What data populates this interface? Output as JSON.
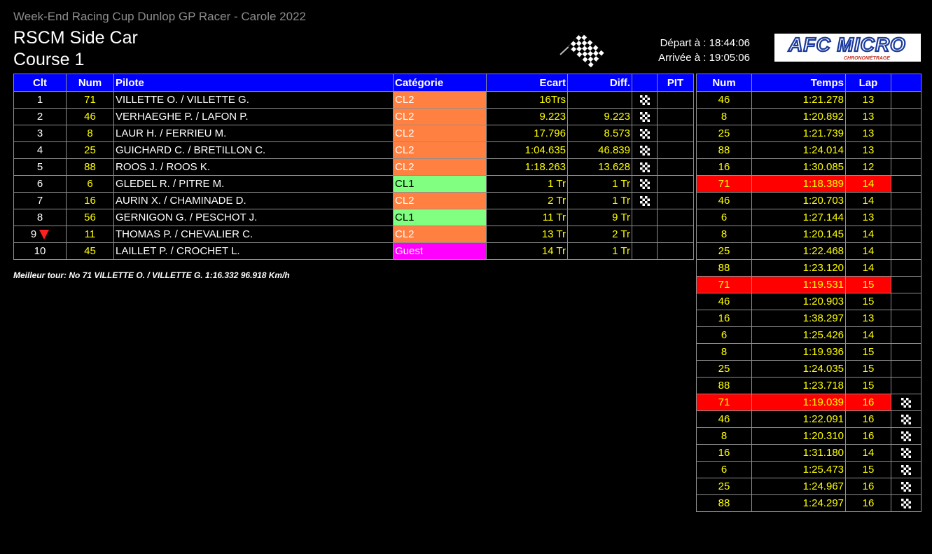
{
  "header": {
    "event": "Week-End Racing Cup Dunlop GP Racer - Carole 2022",
    "series": "RSCM Side Car",
    "race": "Course 1",
    "start": "Départ à : 18:44:06",
    "finish": "Arrivée à : 19:05:06",
    "logo_text": "AFC MICRO",
    "logo_sub": "CHRONOMÉTRAGE"
  },
  "standings": {
    "headers": [
      "Clt",
      "Num",
      "Pilote",
      "Catégorie",
      "Ecart",
      "Diff.",
      "",
      "PIT"
    ],
    "rows": [
      {
        "pos": "1",
        "num": "71",
        "pilot": "VILLETTE O. / VILLETTE G.",
        "cat": "CL2",
        "gap": "16Trs",
        "diff": "",
        "flag": true,
        "pit": "",
        "down": false
      },
      {
        "pos": "2",
        "num": "46",
        "pilot": "VERHAEGHE P. / LAFON P.",
        "cat": "CL2",
        "gap": "9.223",
        "diff": "9.223",
        "flag": true,
        "pit": "",
        "down": false
      },
      {
        "pos": "3",
        "num": "8",
        "pilot": "LAUR H. / FERRIEU M.",
        "cat": "CL2",
        "gap": "17.796",
        "diff": "8.573",
        "flag": true,
        "pit": "",
        "down": false
      },
      {
        "pos": "4",
        "num": "25",
        "pilot": "GUICHARD C. / BRETILLON C.",
        "cat": "CL2",
        "gap": "1:04.635",
        "diff": "46.839",
        "flag": true,
        "pit": "",
        "down": false
      },
      {
        "pos": "5",
        "num": "88",
        "pilot": "ROOS J. / ROOS K.",
        "cat": "CL2",
        "gap": "1:18.263",
        "diff": "13.628",
        "flag": true,
        "pit": "",
        "down": false
      },
      {
        "pos": "6",
        "num": "6",
        "pilot": "GLEDEL R. / PITRE M.",
        "cat": "CL1",
        "gap": "1 Tr",
        "diff": "1 Tr",
        "flag": true,
        "pit": "",
        "down": false
      },
      {
        "pos": "7",
        "num": "16",
        "pilot": "AURIN X. / CHAMINADE D.",
        "cat": "CL2",
        "gap": "2 Tr",
        "diff": "1 Tr",
        "flag": true,
        "pit": "",
        "down": false
      },
      {
        "pos": "8",
        "num": "56",
        "pilot": "GERNIGON G. / PESCHOT J.",
        "cat": "CL1",
        "gap": "11 Tr",
        "diff": "9 Tr",
        "flag": false,
        "pit": "",
        "down": false
      },
      {
        "pos": "9",
        "num": "11",
        "pilot": "THOMAS P. / CHEVALIER C.",
        "cat": "CL2",
        "gap": "13 Tr",
        "diff": "2 Tr",
        "flag": false,
        "pit": "",
        "down": true
      },
      {
        "pos": "10",
        "num": "45",
        "pilot": "LAILLET P. / CROCHET L.",
        "cat": "Guest",
        "gap": "14 Tr",
        "diff": "1 Tr",
        "flag": false,
        "pit": "",
        "down": false
      }
    ]
  },
  "best_lap": "Meilleur tour: No 71 VILLETTE O. / VILLETTE G. 1:16.332 96.918 Km/h",
  "laps": {
    "headers": [
      "Num",
      "Temps",
      "Lap",
      ""
    ],
    "rows": [
      {
        "num": "46",
        "time": "1:21.278",
        "lap": "13",
        "best": false,
        "flag": false
      },
      {
        "num": "8",
        "time": "1:20.892",
        "lap": "13",
        "best": false,
        "flag": false
      },
      {
        "num": "25",
        "time": "1:21.739",
        "lap": "13",
        "best": false,
        "flag": false
      },
      {
        "num": "88",
        "time": "1:24.014",
        "lap": "13",
        "best": false,
        "flag": false
      },
      {
        "num": "16",
        "time": "1:30.085",
        "lap": "12",
        "best": false,
        "flag": false
      },
      {
        "num": "71",
        "time": "1:18.389",
        "lap": "14",
        "best": true,
        "flag": false
      },
      {
        "num": "46",
        "time": "1:20.703",
        "lap": "14",
        "best": false,
        "flag": false
      },
      {
        "num": "6",
        "time": "1:27.144",
        "lap": "13",
        "best": false,
        "flag": false
      },
      {
        "num": "8",
        "time": "1:20.145",
        "lap": "14",
        "best": false,
        "flag": false
      },
      {
        "num": "25",
        "time": "1:22.468",
        "lap": "14",
        "best": false,
        "flag": false
      },
      {
        "num": "88",
        "time": "1:23.120",
        "lap": "14",
        "best": false,
        "flag": false
      },
      {
        "num": "71",
        "time": "1:19.531",
        "lap": "15",
        "best": true,
        "flag": false
      },
      {
        "num": "46",
        "time": "1:20.903",
        "lap": "15",
        "best": false,
        "flag": false
      },
      {
        "num": "16",
        "time": "1:38.297",
        "lap": "13",
        "best": false,
        "flag": false
      },
      {
        "num": "6",
        "time": "1:25.426",
        "lap": "14",
        "best": false,
        "flag": false
      },
      {
        "num": "8",
        "time": "1:19.936",
        "lap": "15",
        "best": false,
        "flag": false
      },
      {
        "num": "25",
        "time": "1:24.035",
        "lap": "15",
        "best": false,
        "flag": false
      },
      {
        "num": "88",
        "time": "1:23.718",
        "lap": "15",
        "best": false,
        "flag": false
      },
      {
        "num": "71",
        "time": "1:19.039",
        "lap": "16",
        "best": true,
        "flag": true
      },
      {
        "num": "46",
        "time": "1:22.091",
        "lap": "16",
        "best": false,
        "flag": true
      },
      {
        "num": "8",
        "time": "1:20.310",
        "lap": "16",
        "best": false,
        "flag": true
      },
      {
        "num": "16",
        "time": "1:31.180",
        "lap": "14",
        "best": false,
        "flag": true
      },
      {
        "num": "6",
        "time": "1:25.473",
        "lap": "15",
        "best": false,
        "flag": true
      },
      {
        "num": "25",
        "time": "1:24.967",
        "lap": "16",
        "best": false,
        "flag": true
      },
      {
        "num": "88",
        "time": "1:24.297",
        "lap": "16",
        "best": false,
        "flag": true
      }
    ]
  },
  "colors": {
    "header_bg": "#0000ff",
    "cl2": "#ff8040",
    "cl1": "#80ff80",
    "guest": "#ff00ff",
    "best_lap": "#ff0000",
    "value": "#ffff00"
  },
  "icons": {
    "finish": "checkered-flag-icon",
    "position_drop": "down-arrow-icon"
  }
}
